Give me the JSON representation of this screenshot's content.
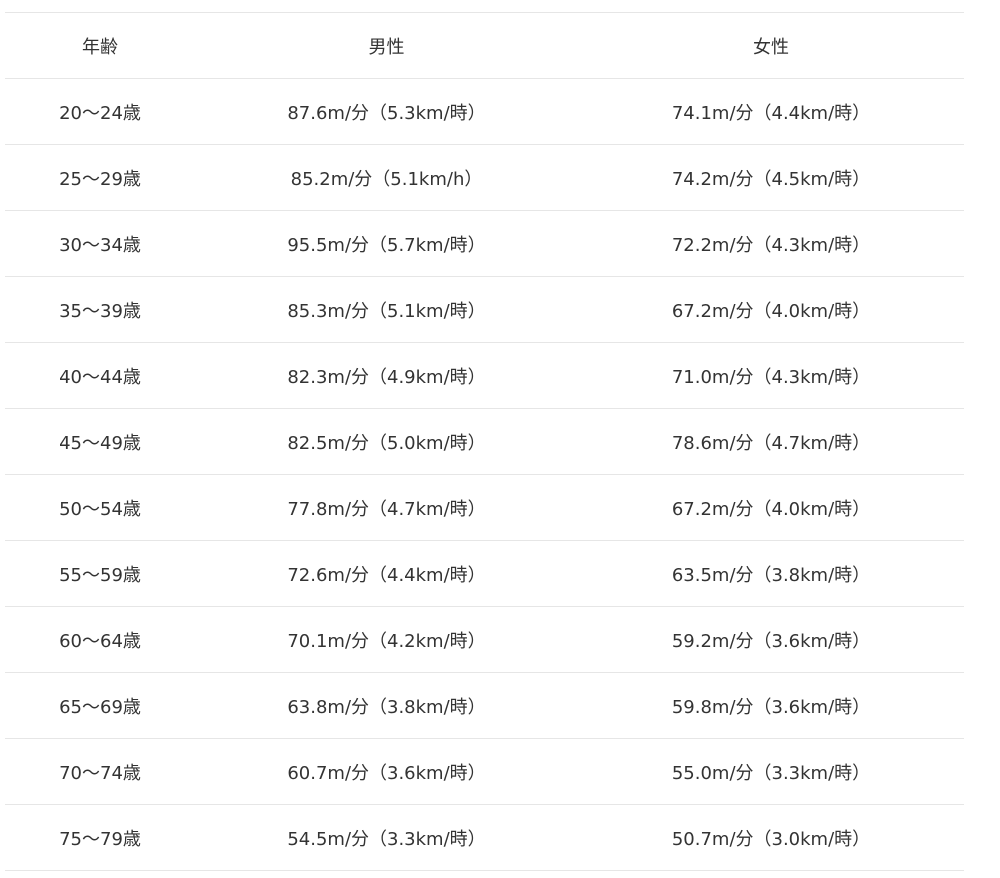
{
  "table": {
    "headers": [
      "年齢",
      "男性",
      "女性"
    ],
    "rows": [
      [
        "20〜24歳",
        "87.6m/分（5.3km/時）",
        "74.1m/分（4.4km/時）"
      ],
      [
        "25〜29歳",
        "85.2m/分（5.1km/h）",
        "74.2m/分（4.5km/時）"
      ],
      [
        "30〜34歳",
        "95.5m/分（5.7km/時）",
        "72.2m/分（4.3km/時）"
      ],
      [
        "35〜39歳",
        "85.3m/分（5.1km/時）",
        "67.2m/分（4.0km/時）"
      ],
      [
        "40〜44歳",
        "82.3m/分（4.9km/時）",
        "71.0m/分（4.3km/時）"
      ],
      [
        "45〜49歳",
        "82.5m/分（5.0km/時）",
        "78.6m/分（4.7km/時）"
      ],
      [
        "50〜54歳",
        "77.8m/分（4.7km/時）",
        "67.2m/分（4.0km/時）"
      ],
      [
        "55〜59歳",
        "72.6m/分（4.4km/時）",
        "63.5m/分（3.8km/時）"
      ],
      [
        "60〜64歳",
        "70.1m/分（4.2km/時）",
        "59.2m/分（3.6km/時）"
      ],
      [
        "65〜69歳",
        "63.8m/分（3.8km/時）",
        "59.8m/分（3.6km/時）"
      ],
      [
        "70〜74歳",
        "60.7m/分（3.6km/時）",
        "55.0m/分（3.3km/時）"
      ],
      [
        "75〜79歳",
        "54.5m/分（3.3km/時）",
        "50.7m/分（3.0km/時）"
      ]
    ]
  }
}
